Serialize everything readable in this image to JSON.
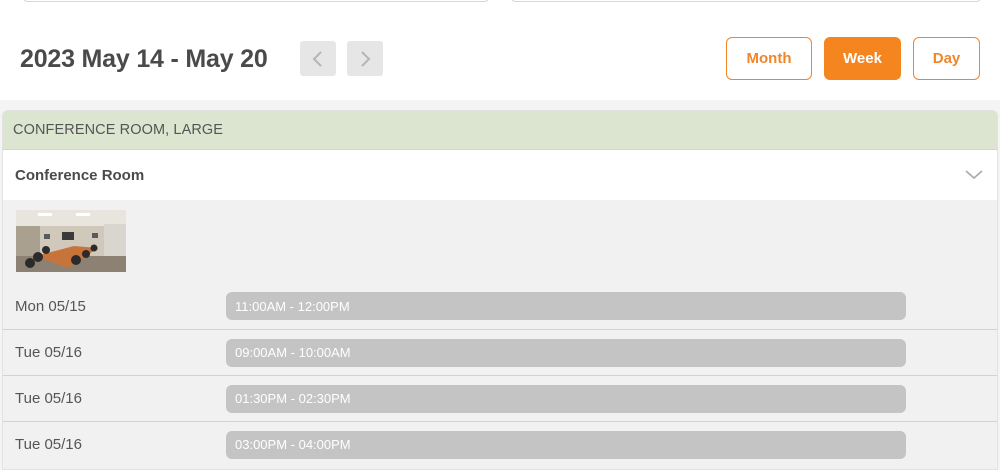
{
  "header": {
    "range_title": "2023 May 14 - May 20",
    "prev_icon": "chevron-left-icon",
    "next_icon": "chevron-right-icon",
    "views": {
      "month": "Month",
      "week": "Week",
      "day": "Day"
    },
    "active_view": "Week",
    "accent_color": "#f5851f"
  },
  "category": {
    "label": "CONFERENCE ROOM, LARGE",
    "color": "#dbe5d0"
  },
  "room": {
    "name": "Conference Room",
    "expand_icon": "chevron-down-icon",
    "photo_icon": "conference-room-photo"
  },
  "slots": [
    {
      "date": "Mon 05/15",
      "time": "11:00AM - 12:00PM"
    },
    {
      "date": "Tue 05/16",
      "time": "09:00AM - 10:00AM"
    },
    {
      "date": "Tue 05/16",
      "time": "01:30PM - 02:30PM"
    },
    {
      "date": "Tue 05/16",
      "time": "03:00PM - 04:00PM"
    }
  ]
}
